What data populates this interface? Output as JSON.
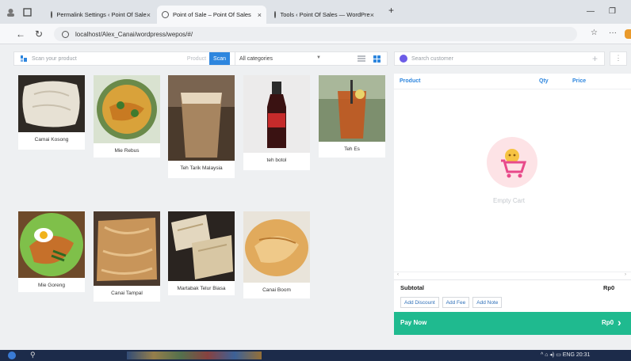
{
  "browser": {
    "tabs": [
      {
        "label": "Permalink Settings ‹ Point Of Sale",
        "active": false
      },
      {
        "label": "Point of Sale – Point Of Sales",
        "active": true
      },
      {
        "label": "Tools ‹ Point Of Sales — WordPre",
        "active": false
      }
    ],
    "new_tab": "+",
    "url": "localhost/Alex_Canai/wordpress/wepos/#/"
  },
  "toolbar": {
    "scan_placeholder": "Scan your product",
    "mode_label": "Product",
    "scan_button": "Scan",
    "category_selected": "All categories"
  },
  "products": [
    {
      "name": "Camai Kosong",
      "image": "roti-canai-kosong"
    },
    {
      "name": "Mie Rebus",
      "image": "mee-rebus"
    },
    {
      "name": "Teh Tarik Malaysia",
      "image": "teh-tarik"
    },
    {
      "name": "teh botol",
      "image": "teh-botol-bottle"
    },
    {
      "name": "Teh Es",
      "image": "iced-tea"
    },
    {
      "name": "Mie Goreng",
      "image": "mee-goreng"
    },
    {
      "name": "Canai Tampal",
      "image": "roti-canai-tampal"
    },
    {
      "name": "Martabak Telur Biasa",
      "image": "martabak-telur"
    },
    {
      "name": "Canai Boom",
      "image": "roti-canai-boom"
    }
  ],
  "customer": {
    "search_placeholder": "Search customer"
  },
  "cart": {
    "columns": [
      "Product",
      "Qty",
      "Price"
    ],
    "empty_label": "Empty Cart",
    "subtotal_label": "Subtotal",
    "subtotal_value": "Rp0",
    "actions": [
      "Add Discount",
      "Add Fee",
      "Add Note"
    ],
    "pay_label": "Pay Now",
    "pay_value": "Rp0"
  },
  "taskbar": {
    "tray": "ENG",
    "time": "20:31"
  },
  "colors": {
    "accent": "#2e86de",
    "pay": "#1fba8f",
    "empty_cart_bg": "#fde3e6"
  }
}
